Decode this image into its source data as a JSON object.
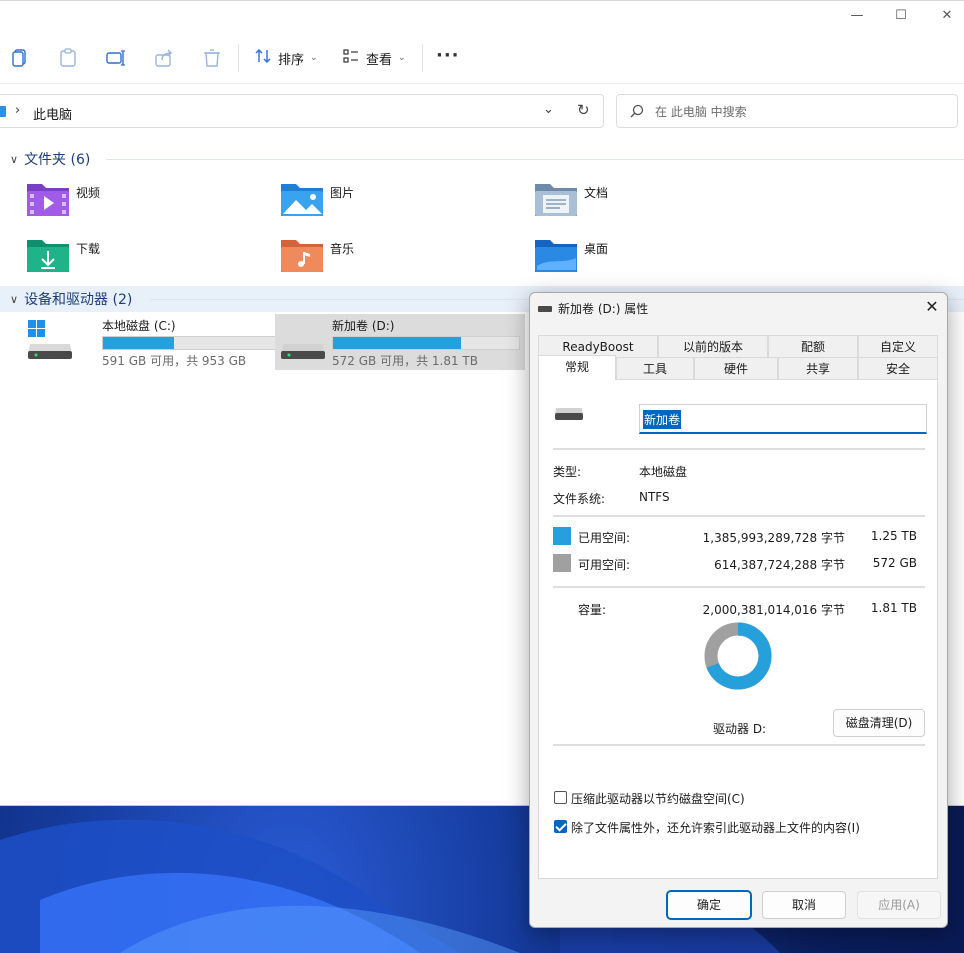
{
  "explorer": {
    "window_controls": {
      "minimize": "—",
      "maximize": "☐",
      "close": "✕"
    },
    "toolbar": {
      "sort_label": "排序",
      "view_label": "查看",
      "more_label": "···"
    },
    "address": {
      "path": "此电脑"
    },
    "search": {
      "placeholder": "在 此电脑 中搜索"
    },
    "folders_section": {
      "title": "文件夹 (6)",
      "items": [
        {
          "label": "视频",
          "icon": "videos-folder-icon"
        },
        {
          "label": "图片",
          "icon": "pictures-folder-icon"
        },
        {
          "label": "文档",
          "icon": "documents-folder-icon"
        },
        {
          "label": "下载",
          "icon": "downloads-folder-icon"
        },
        {
          "label": "音乐",
          "icon": "music-folder-icon"
        },
        {
          "label": "桌面",
          "icon": "desktop-folder-icon"
        }
      ]
    },
    "drives_section": {
      "title": "设备和驱动器 (2)",
      "items": [
        {
          "label": "本地磁盘 (C:)",
          "size": "591 GB 可用，共 953 GB",
          "used_fraction": 0.38
        },
        {
          "label": "新加卷 (D:)",
          "size": "572 GB 可用，共 1.81 TB",
          "used_fraction": 0.69
        }
      ]
    }
  },
  "dialog": {
    "title": "新加卷 (D:) 属性",
    "close": "✕",
    "tabs_row1": [
      "ReadyBoost",
      "以前的版本",
      "配额",
      "自定义"
    ],
    "tabs_row2": [
      "常规",
      "工具",
      "硬件",
      "共享",
      "安全"
    ],
    "active_tab": "常规",
    "volume_name": "新加卷",
    "type_label": "类型:",
    "type_value": "本地磁盘",
    "fs_label": "文件系统:",
    "fs_value": "NTFS",
    "used": {
      "label": "已用空间:",
      "bytes": "1,385,993,289,728 字节",
      "size": "1.25 TB",
      "color": "#26a0da"
    },
    "free": {
      "label": "可用空间:",
      "bytes": "614,387,724,288 字节",
      "size": "572 GB",
      "color": "#a0a0a0"
    },
    "capacity": {
      "label": "容量:",
      "bytes": "2,000,381,014,016 字节",
      "size": "1.81 TB"
    },
    "used_fraction": 0.693,
    "drive_label": "驱动器 D:",
    "cleanup_button": "磁盘清理(D)",
    "compress": {
      "label": "压缩此驱动器以节约磁盘空间(C)",
      "checked": false
    },
    "index": {
      "label": "除了文件属性外，还允许索引此驱动器上文件的内容(I)",
      "checked": true
    },
    "buttons": {
      "ok": "确定",
      "cancel": "取消",
      "apply": "应用(A)"
    }
  }
}
